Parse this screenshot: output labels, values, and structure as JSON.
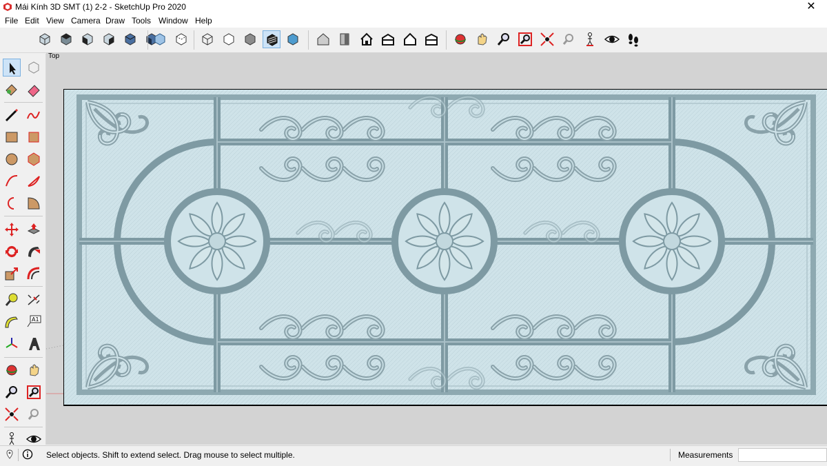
{
  "window": {
    "title": "Mái Kính 3D SMT (1) 2-2 - SketchUp Pro 2020",
    "close_glyph": "✕"
  },
  "menu": [
    "File",
    "Edit",
    "View",
    "Camera",
    "Draw",
    "Tools",
    "Window",
    "Help"
  ],
  "toolbar": {
    "views": [
      "iso-view-icon",
      "top-view-icon",
      "front-view-icon",
      "right-view-icon",
      "back-view-icon",
      "left-view-icon"
    ],
    "styles": [
      "xray-icon",
      "back-edges-icon",
      "wireframe-icon",
      "hidden-line-icon",
      "shaded-icon",
      "shaded-textures-icon",
      "monochrome-icon"
    ],
    "warehouse": [
      "3d-warehouse-icon",
      "extension-warehouse-icon",
      "home-icon",
      "section-plane-icon",
      "house-outline-icon",
      "component-house-icon"
    ],
    "camera": [
      "orbit-icon",
      "pan-icon",
      "zoom-icon",
      "zoom-window-icon",
      "zoom-extents-icon",
      "previous-view-icon",
      "position-camera-icon",
      "look-around-icon",
      "walk-icon"
    ]
  },
  "left_tools": [
    "select",
    "make-component",
    "paint-bucket",
    "eraser",
    "line",
    "freehand",
    "rectangle",
    "rotated-rectangle",
    "circle",
    "polygon",
    "arc",
    "pie",
    "2-point-arc",
    "3-point-arc",
    "move",
    "push-pull",
    "rotate",
    "follow-me",
    "scale",
    "offset",
    "tape-measure",
    "dimension",
    "protractor",
    "text",
    "axes",
    "3d-text",
    "orbit",
    "pan",
    "zoom",
    "zoom-window",
    "zoom-extents",
    "previous-view",
    "position-camera",
    "look-around"
  ],
  "scene": {
    "label": "Top"
  },
  "status": {
    "message": "Select objects. Shift to extend select. Drag mouse to select multiple.",
    "measurements_label": "Measurements",
    "measurements_value": ""
  },
  "colors": {
    "glass": "#cfe3e9",
    "frame": "#7e9aa3",
    "viewport": "#d3d3d3",
    "accent": "#1a73c8"
  }
}
